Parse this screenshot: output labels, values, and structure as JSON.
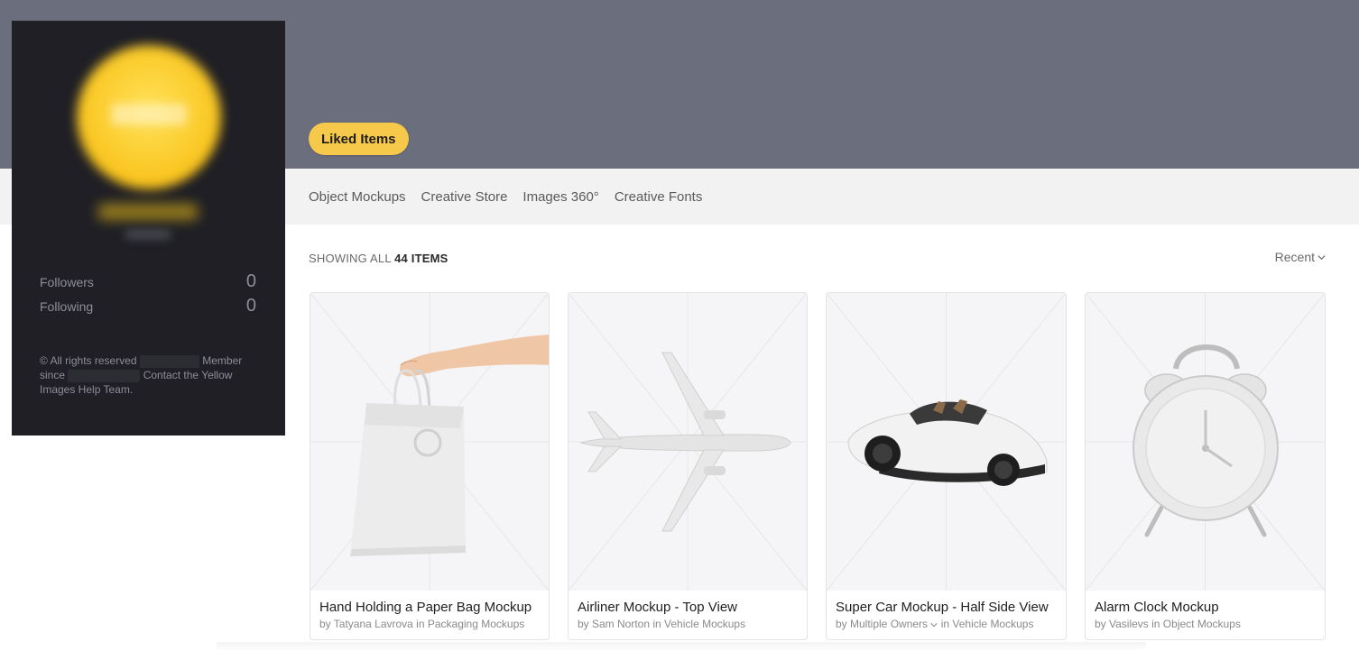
{
  "header": {
    "liked_items_label": "Liked Items",
    "tabs": [
      {
        "label": "Object Mockups"
      },
      {
        "label": "Creative Store"
      },
      {
        "label": "Images 360°"
      },
      {
        "label": "Creative Fonts"
      }
    ]
  },
  "sidebar": {
    "followers_label": "Followers",
    "followers_value": "0",
    "following_label": "Following",
    "following_value": "0",
    "footer_part1": "© All rights reserved",
    "footer_part2": "Member",
    "footer_part3": "since",
    "footer_part4": "Contact the Yellow Images Help Team."
  },
  "listing": {
    "showing_prefix": "SHOWING ALL",
    "showing_count": "44 ITEMS",
    "sort_label": "Recent"
  },
  "products": [
    {
      "title": "Hand Holding a Paper Bag Mockup",
      "meta": "by Tatyana Lavrova in Packaging Mockups",
      "icon": "paper-bag"
    },
    {
      "title": "Airliner Mockup - Top View",
      "meta": "by Sam Norton in Vehicle Mockups",
      "icon": "airplane"
    },
    {
      "title": "Super Car Mockup - Half Side View",
      "meta_prefix": "by Multiple Owners",
      "meta_suffix": "in Vehicle Mockups",
      "icon": "sports-car"
    },
    {
      "title": "Alarm Clock Mockup",
      "meta": "by Vasilevs in Object Mockups",
      "icon": "alarm-clock"
    }
  ],
  "colors": {
    "banner": "#6b6e7d",
    "accent": "#f6c94a",
    "sidebar": "#1f1f25"
  }
}
